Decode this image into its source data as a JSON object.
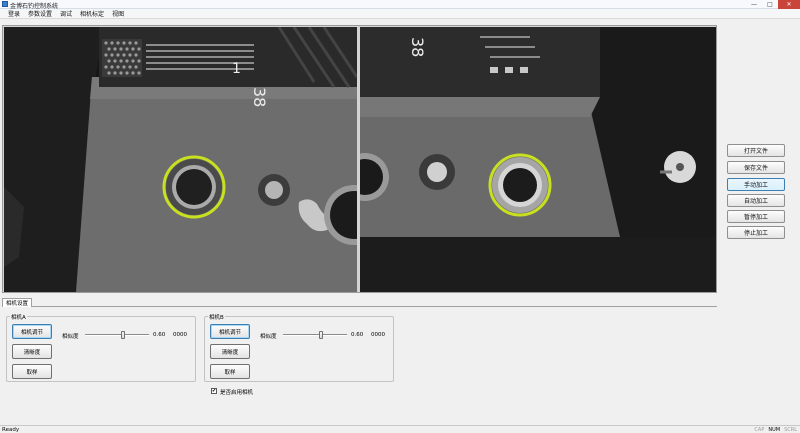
{
  "window": {
    "title": "金博石钓控制系统",
    "controls": {
      "minimize": "—",
      "maximize": "□",
      "close": "✕"
    }
  },
  "menu": [
    "登录",
    "参数设置",
    "调试",
    "相机标定",
    "视图"
  ],
  "views": {
    "left": {
      "fiducial_label": "1",
      "board_number": "38"
    },
    "right": {
      "board_number": "38"
    }
  },
  "side_buttons": [
    {
      "label": "打开文件",
      "active": false
    },
    {
      "label": "保存文件",
      "active": false
    },
    {
      "label": "手动加工",
      "active": true
    },
    {
      "label": "自动加工",
      "active": false
    },
    {
      "label": "暂停加工",
      "active": false
    },
    {
      "label": "停止加工",
      "active": false
    }
  ],
  "tabs": [
    {
      "label": "相机设置"
    }
  ],
  "cameras": [
    {
      "group_title": "相机A",
      "adjust_label": "相机调节",
      "clear_label": "清晰度",
      "grab_label": "取样",
      "sensitivity_label": "相似度",
      "slider_value": 0.6,
      "value_text": "0.60",
      "score_text": "0000"
    },
    {
      "group_title": "相机B",
      "adjust_label": "相机调节",
      "clear_label": "清晰度",
      "grab_label": "取样",
      "sensitivity_label": "相似度",
      "slider_value": 0.6,
      "value_text": "0.60",
      "score_text": "0000"
    }
  ],
  "options": {
    "dual_camera_label": "是否启用相机",
    "dual_camera_checked": true,
    "check_mark": "✔"
  },
  "status": {
    "text": "Ready",
    "indicators": [
      {
        "label": "CAP",
        "on": false
      },
      {
        "label": "NUM",
        "on": true
      },
      {
        "label": "SCRL",
        "on": false
      }
    ]
  },
  "colors": {
    "target_ring": "#c8e020",
    "active_border": "#3c7fb1",
    "close_button": "#c9453b"
  }
}
